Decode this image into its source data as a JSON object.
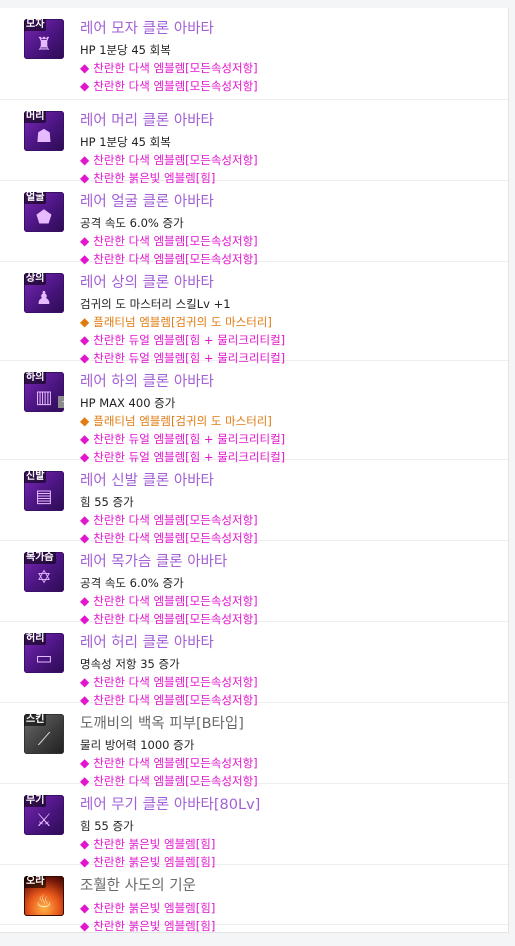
{
  "colors": {
    "title_purple": "#a35fd6",
    "title_plain": "#6a6a6a",
    "emblem_pink": "#e116ce",
    "emblem_orange": "#e07a11"
  },
  "items": [
    {
      "icon": {
        "tag": "모자",
        "glyph": "♜",
        "name": "hat-avatar-icon"
      },
      "title": "레어 모자 클론 아바타",
      "stat": "HP 1분당 45 회복",
      "emblems": [
        {
          "text": "찬란한 다색 엠블렘[모든속성저항]",
          "color": "pink"
        },
        {
          "text": "찬란한 다색 엠블렘[모든속성저항]",
          "color": "pink"
        }
      ]
    },
    {
      "icon": {
        "tag": "머리",
        "glyph": "☗",
        "name": "hair-avatar-icon"
      },
      "title": "레어 머리 클론 아바타",
      "stat": "HP 1분당 45 회복",
      "emblems": [
        {
          "text": "찬란한 다색 엠블렘[모든속성저항]",
          "color": "pink"
        },
        {
          "text": "찬란한 붉은빛 엠블렘[힘]",
          "color": "pink"
        }
      ]
    },
    {
      "icon": {
        "tag": "얼굴",
        "glyph": "⬟",
        "name": "face-avatar-icon"
      },
      "title": "레어 얼굴 클론 아바타",
      "stat": "공격 속도 6.0% 증가",
      "emblems": [
        {
          "text": "찬란한 다색 엠블렘[모든속성저항]",
          "color": "pink"
        },
        {
          "text": "찬란한 다색 엠블렘[모든속성저항]",
          "color": "pink"
        }
      ]
    },
    {
      "icon": {
        "tag": "상의",
        "glyph": "♟",
        "name": "top-avatar-icon"
      },
      "title": "레어 상의 클론 아바타",
      "stat": "검귀의 도 마스터리 스킬Lv +1",
      "emblems": [
        {
          "text": "플래티넘 엠블렘[검귀의 도 마스터리]",
          "color": "orange"
        },
        {
          "text": "찬란한 듀얼 엠블렘[힘 + 물리크리티컬]",
          "color": "pink"
        },
        {
          "text": "찬란한 듀얼 엠블렘[힘 + 물리크리티컬]",
          "color": "pink"
        }
      ]
    },
    {
      "icon": {
        "tag": "하의",
        "glyph": "▥",
        "name": "bottom-avatar-icon",
        "badge": "+"
      },
      "title": "레어 하의 클론 아바타",
      "stat": "HP MAX 400 증가",
      "emblems": [
        {
          "text": "플래티넘 엠블렘[검귀의 도 마스터리]",
          "color": "orange"
        },
        {
          "text": "찬란한 듀얼 엠블렘[힘 + 물리크리티컬]",
          "color": "pink"
        },
        {
          "text": "찬란한 듀얼 엠블렘[힘 + 물리크리티컬]",
          "color": "pink"
        }
      ]
    },
    {
      "icon": {
        "tag": "신발",
        "glyph": "▤",
        "name": "shoes-avatar-icon"
      },
      "title": "레어 신발 클론 아바타",
      "stat": "힘 55 증가",
      "emblems": [
        {
          "text": "찬란한 다색 엠블렘[모든속성저항]",
          "color": "pink"
        },
        {
          "text": "찬란한 다색 엠블렘[모든속성저항]",
          "color": "pink"
        }
      ]
    },
    {
      "icon": {
        "tag": "목가슴",
        "glyph": "✡",
        "name": "neck-avatar-icon"
      },
      "title": "레어 목가슴 클론 아바타",
      "stat": "공격 속도 6.0% 증가",
      "emblems": [
        {
          "text": "찬란한 다색 엠블렘[모든속성저항]",
          "color": "pink"
        },
        {
          "text": "찬란한 다색 엠블렘[모든속성저항]",
          "color": "pink"
        }
      ]
    },
    {
      "icon": {
        "tag": "허리",
        "glyph": "▭",
        "name": "belt-avatar-icon"
      },
      "title": "레어 허리 클론 아바타",
      "stat": "명속성 저항 35 증가",
      "emblems": [
        {
          "text": "찬란한 다색 엠블렘[모든속성저항]",
          "color": "pink"
        },
        {
          "text": "찬란한 다색 엠블렘[모든속성저항]",
          "color": "pink"
        }
      ]
    },
    {
      "icon": {
        "tag": "스킨",
        "glyph": "⟋",
        "name": "skin-avatar-icon",
        "style": "gray"
      },
      "title": "도깨비의 백옥 피부[B타입]",
      "title_plain": true,
      "stat": "물리 방어력 1000 증가",
      "emblems": [
        {
          "text": "찬란한 다색 엠블렘[모든속성저항]",
          "color": "pink"
        },
        {
          "text": "찬란한 다색 엠블렘[모든속성저항]",
          "color": "pink"
        }
      ]
    },
    {
      "icon": {
        "tag": "무기",
        "glyph": "⚔",
        "name": "weapon-avatar-icon"
      },
      "title": "레어 무기 클론 아바타[80Lv]",
      "stat": "힘 55 증가",
      "emblems": [
        {
          "text": "찬란한 붉은빛 엠블렘[힘]",
          "color": "pink"
        },
        {
          "text": "찬란한 붉은빛 엠블렘[힘]",
          "color": "pink"
        }
      ]
    },
    {
      "icon": {
        "tag": "오라",
        "glyph": "♨",
        "name": "aura-avatar-icon",
        "style": "fire"
      },
      "title": "조훨한 사도의 기운",
      "title_plain": true,
      "stat": "",
      "emblems": [
        {
          "text": "찬란한 붉은빛 엠블렘[힘]",
          "color": "pink"
        },
        {
          "text": "찬란한 붉은빛 엠블렘[힘]",
          "color": "pink"
        }
      ]
    }
  ]
}
